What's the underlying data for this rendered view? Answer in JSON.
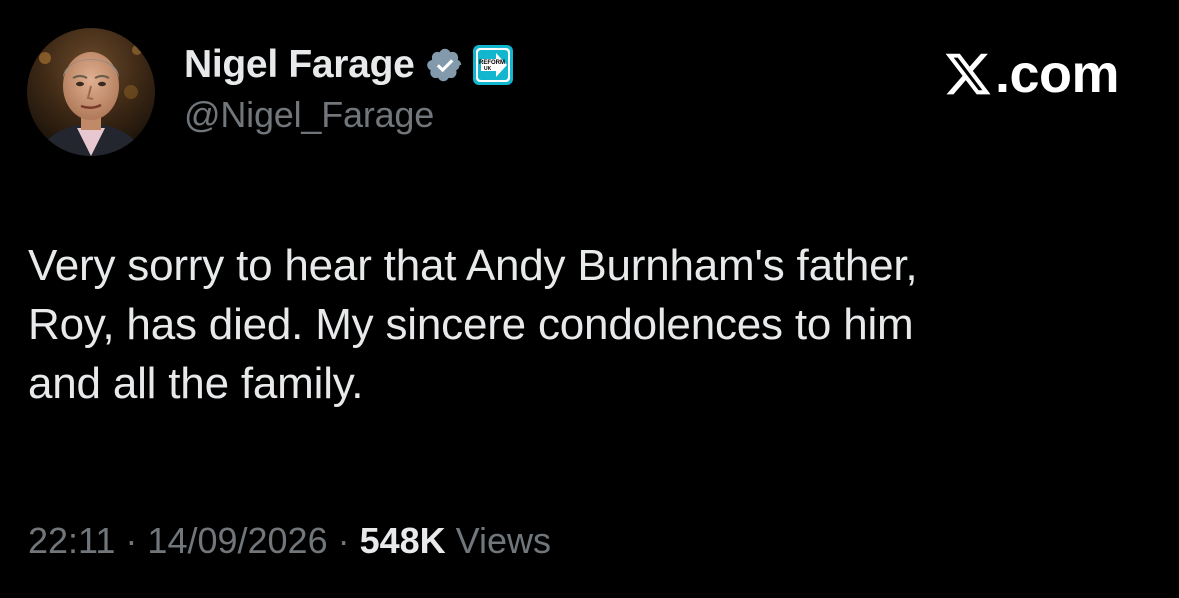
{
  "watermark": {
    "logo_icon": "x-logo-icon",
    "text": ".com"
  },
  "author": {
    "display_name": "Nigel Farage",
    "handle": "@Nigel_Farage",
    "verified_icon": "verified-badge-icon",
    "verified_color": "#829aab",
    "affiliate_badge": {
      "icon": "reform-uk-badge-icon",
      "text_line1": "REFORM",
      "text_line2": "UK",
      "color": "#12b6cf"
    },
    "avatar_icon": "profile-photo-avatar"
  },
  "tweet": {
    "text": "Very sorry to hear that Andy Burnham's father,\nRoy, has died. My sincere condolences to him\nand all the family."
  },
  "meta": {
    "time": "22:11",
    "separator": "·",
    "date": "14/09/2026",
    "views_count": "548K",
    "views_label": "Views"
  },
  "colors": {
    "background": "#000000",
    "primary_text": "#e7e9ea",
    "secondary_text": "#71767b"
  }
}
